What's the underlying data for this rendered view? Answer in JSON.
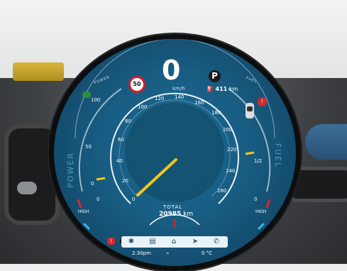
{
  "cluster": {
    "speed": "0",
    "speed_unit": "km/h",
    "gear": "P",
    "range_value": "411",
    "range_unit": "km",
    "speed_limit": "50",
    "power_label_top": "POWER",
    "fuel_label_top": "FUEL",
    "side_power_label": "POWER",
    "side_fuel_label": "FUEL",
    "total_label": "TOTAL",
    "total_value": "20985",
    "total_unit": "km",
    "fuel_half_label": "1/2",
    "power_ticks": [
      "0",
      "50",
      "100"
    ],
    "speed_ticks": [
      "0",
      "20",
      "40",
      "60",
      "80",
      "100",
      "120",
      "140",
      "160",
      "180",
      "200",
      "220",
      "240",
      "260"
    ],
    "left_high_label": "HIGH",
    "right_high_label": "HIGH",
    "left_zero": "0",
    "right_zero": "0",
    "colors": {
      "accent_yellow": "#f3c81b",
      "dial_bg": "#185c82",
      "warning_red": "#d8282f",
      "status_green": "#2a8f3a"
    }
  },
  "status_bar": {
    "time": "2:30pm",
    "temperature": "0 °C"
  },
  "dock": {
    "items": [
      {
        "icon": "fan-icon"
      },
      {
        "icon": "media-icon"
      },
      {
        "icon": "home-icon"
      },
      {
        "icon": "navigation-icon"
      },
      {
        "icon": "phone-icon"
      }
    ],
    "right_icon": "settings-icon"
  },
  "indicators": {
    "info": "i",
    "warning": "!"
  }
}
